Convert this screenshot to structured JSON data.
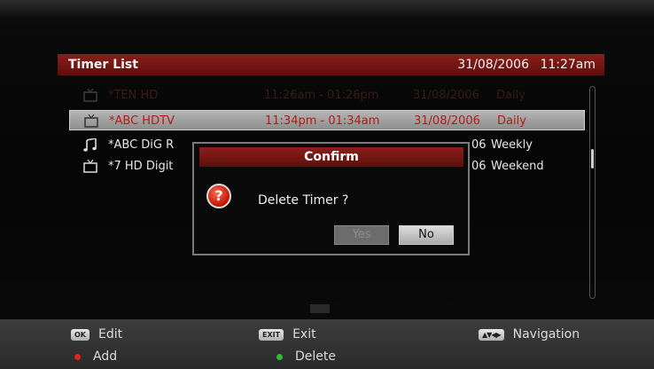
{
  "header": {
    "title": "Timer List",
    "date": "31/08/2006",
    "time": "11:27am"
  },
  "timers": [
    {
      "type": "tv-icon",
      "name": "*TEN HD",
      "time": "11:26am - 01:26pm",
      "date": "31/08/2006",
      "repeat": "Daily"
    },
    {
      "type": "tv-icon",
      "name": "*ABC HDTV",
      "time": "11:34pm - 01:34am",
      "date": "31/08/2006",
      "repeat": "Daily"
    },
    {
      "type": "radio-icon",
      "name": "*ABC DiG R",
      "time": "",
      "date": "06",
      "repeat": "Weekly"
    },
    {
      "type": "tv-icon",
      "name": "*7 HD Digit",
      "time": "",
      "date": "06",
      "repeat": "Weekend"
    }
  ],
  "dialog": {
    "title": "Confirm",
    "message": "Delete Timer ?",
    "icon": "question-icon",
    "yes": "Yes",
    "no": "No"
  },
  "footer": {
    "ok_key": "OK",
    "edit": "Edit",
    "exit_key": "EXIT",
    "exit": "Exit",
    "nav_key": "▲▼◀▶",
    "navigation": "Navigation",
    "add": "Add",
    "delete": "Delete"
  },
  "colors": {
    "accent": "#7a1a16",
    "red_key": "#e0241b",
    "green_key": "#2dbb3a",
    "selected_text": "#b01d14"
  }
}
